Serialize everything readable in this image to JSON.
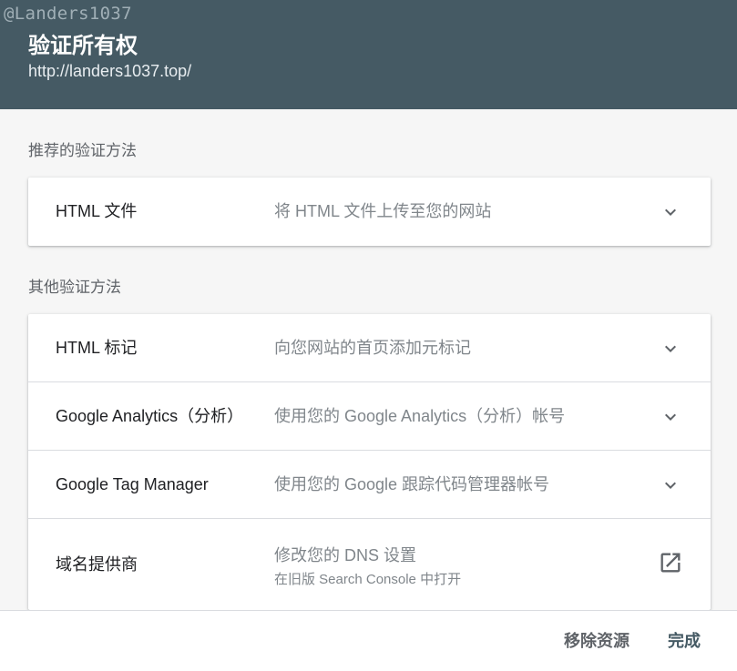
{
  "watermark": "@Landers1037",
  "dialog": {
    "title": "验证所有权",
    "subtitle": "http://landers1037.top/"
  },
  "recommended": {
    "label": "推荐的验证方法",
    "methods": [
      {
        "name": "HTML 文件",
        "description": "将 HTML 文件上传至您的网站",
        "icon": "chevron-down-icon"
      }
    ]
  },
  "other": {
    "label": "其他验证方法",
    "methods": [
      {
        "name": "HTML 标记",
        "description": "向您网站的首页添加元标记",
        "icon": "chevron-down-icon"
      },
      {
        "name": "Google Analytics（分析）",
        "description": "使用您的 Google Analytics（分析）帐号",
        "icon": "chevron-down-icon"
      },
      {
        "name": "Google Tag Manager",
        "description": "使用您的 Google 跟踪代码管理器帐号",
        "icon": "chevron-down-icon"
      },
      {
        "name": "域名提供商",
        "description": "修改您的 DNS 设置",
        "sub_description": "在旧版 Search Console 中打开",
        "icon": "open-in-new-icon"
      }
    ]
  },
  "footer": {
    "remove_label": "移除资源",
    "done_label": "完成"
  },
  "colors": {
    "header_bg": "#455a64",
    "content_bg": "#f6f6f6",
    "card_bg": "#ffffff",
    "muted_text": "#80868b"
  }
}
